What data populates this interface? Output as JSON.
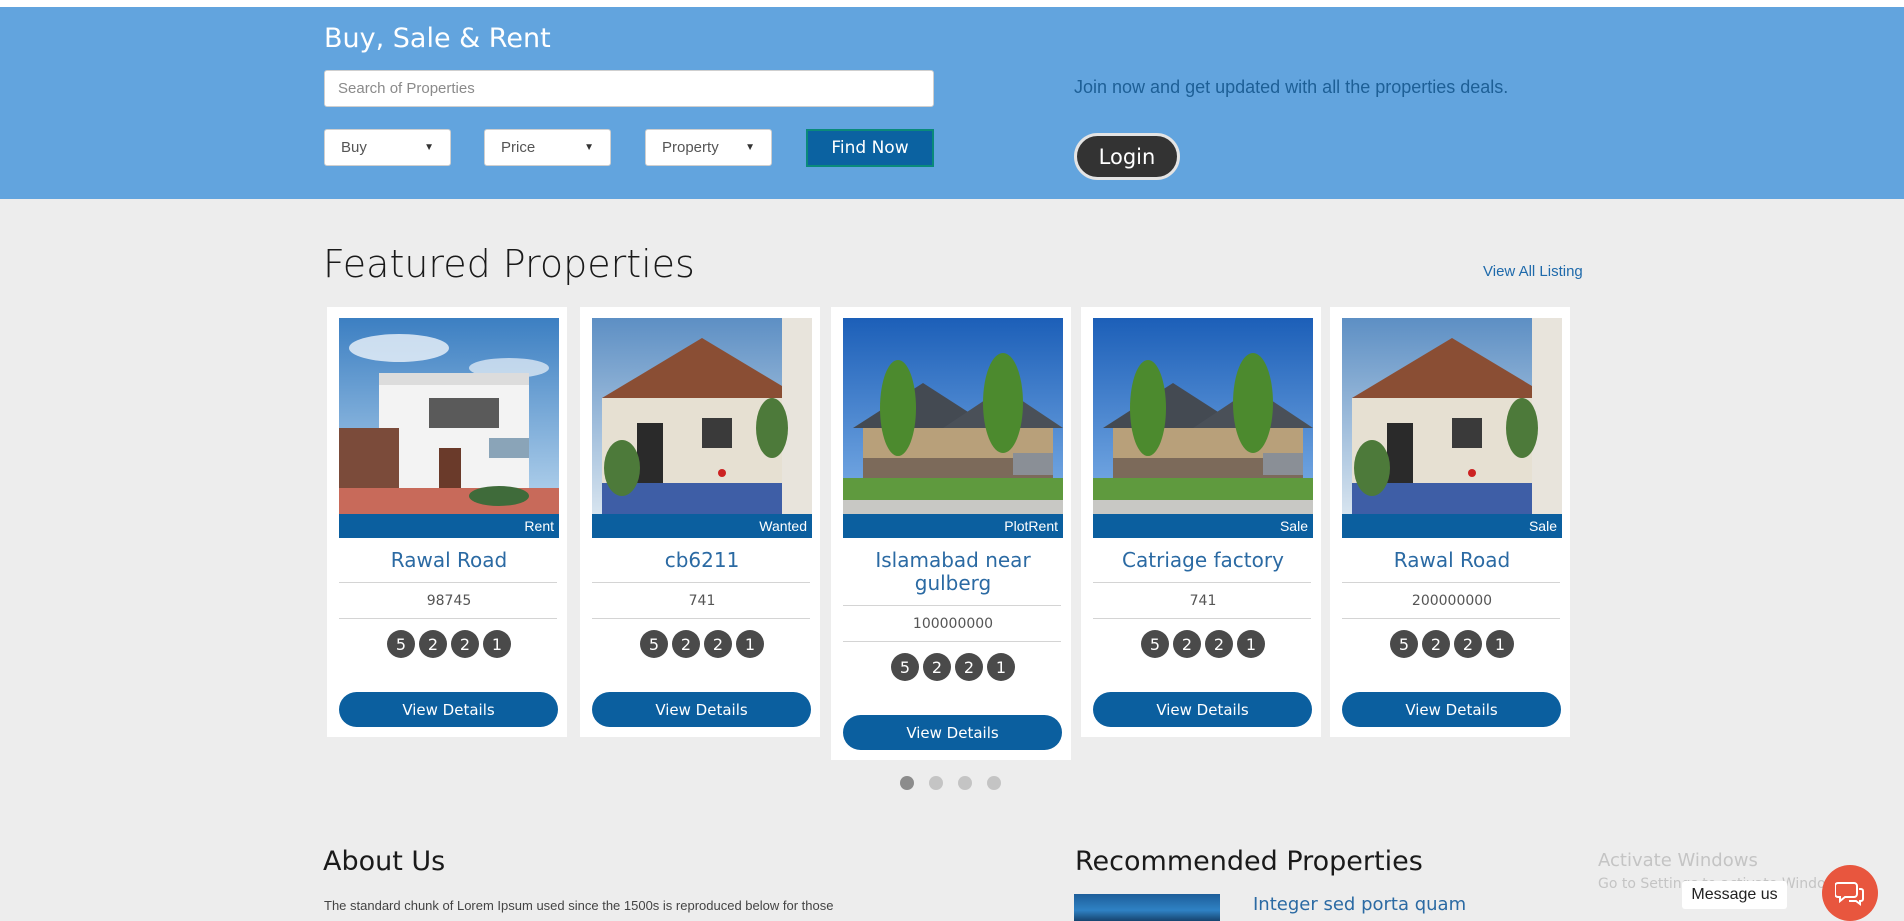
{
  "hero": {
    "title": "Buy, Sale & Rent",
    "search_placeholder": "Search of Properties",
    "filters": [
      {
        "label": "Buy"
      },
      {
        "label": "Price"
      },
      {
        "label": "Property"
      }
    ],
    "find_label": "Find Now",
    "join_text": "Join now and get updated with all the properties deals.",
    "login_label": "Login",
    "bg_color": "#62a4de"
  },
  "featured": {
    "title": "Featured Properties",
    "view_all": "View All Listing",
    "cards": [
      {
        "tag": "Rent",
        "name": "Rawal Road",
        "price": "98745",
        "features": [
          "5",
          "2",
          "2",
          "1"
        ],
        "button": "View Details",
        "image": "modern-white-house"
      },
      {
        "tag": "Wanted",
        "name": "cb6211",
        "price": "741",
        "features": [
          "5",
          "2",
          "2",
          "1"
        ],
        "button": "View Details",
        "image": "old-cottage"
      },
      {
        "tag": "PlotRent",
        "name": "Islamabad near gulberg",
        "price": "100000000",
        "features": [
          "5",
          "2",
          "2",
          "1"
        ],
        "button": "View Details",
        "image": "suburban-house"
      },
      {
        "tag": "Sale",
        "name": "Catriage factory",
        "price": "741",
        "features": [
          "5",
          "2",
          "2",
          "1"
        ],
        "button": "View Details",
        "image": "suburban-house"
      },
      {
        "tag": "Sale",
        "name": "Rawal Road",
        "price": "200000000",
        "features": [
          "5",
          "2",
          "2",
          "1"
        ],
        "button": "View Details",
        "image": "old-cottage"
      }
    ],
    "pagination_count": 4,
    "active_page": 1
  },
  "about": {
    "title": "About Us",
    "text": "The standard chunk of Lorem Ipsum used since the 1500s is reproduced below for those"
  },
  "recommended": {
    "title": "Recommended Properties",
    "first_item": "Integer sed porta quam"
  },
  "overlay": {
    "watermark_title": "Activate Windows",
    "watermark_sub": "Go to Settings to activate Windows.",
    "message_label": "Message us",
    "chat_icon": "chat-bubbles-icon"
  },
  "colors": {
    "primary_blue": "#0b5f9f",
    "link_blue": "#2b6aa3",
    "chat_red": "#e8563e"
  }
}
